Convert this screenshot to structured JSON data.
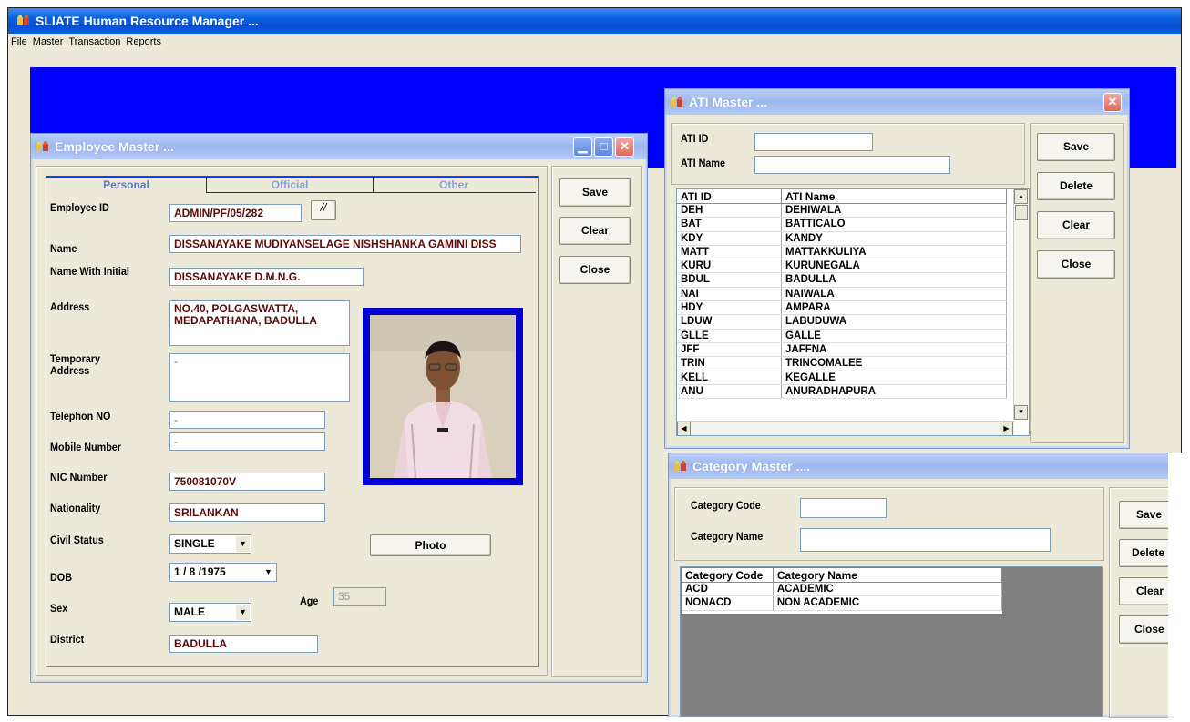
{
  "app": {
    "title": "SLIATE Human Resource Manager ...",
    "menu": [
      "File",
      "Master",
      "Transaction",
      "Reports"
    ]
  },
  "employee": {
    "title": "Employee Master ...",
    "tabs": [
      "Personal",
      "Official",
      "Other"
    ],
    "labels": {
      "employee_id": "Employee ID",
      "name": "Name",
      "name_initial": "Name With Initial",
      "address": "Address",
      "temp_address": "Temporary Address",
      "telephone": "Telephon NO",
      "mobile": "Mobile Number",
      "nic": "NIC Number",
      "nationality": "Nationality",
      "civil_status": "Civil Status",
      "dob": "DOB",
      "sex": "Sex",
      "district": "District",
      "age": "Age"
    },
    "values": {
      "employee_id": "ADMIN/PF/05/282",
      "id_button": "//",
      "name": "DISSANAYAKE MUDIYANSELAGE NISHSHANKA GAMINI DISS",
      "name_initial": "DISSANAYAKE D.M.N.G.",
      "address": "NO.40, POLGASWATTA, MEDAPATHANA, BADULLA",
      "temp_address": "-",
      "telephone": "-",
      "mobile": "-",
      "nic": "750081070V",
      "nationality": "SRILANKAN",
      "civil_status": "SINGLE",
      "dob": "1 / 8 /1975",
      "sex": "MALE",
      "district": "BADULLA",
      "age": "35"
    },
    "photo_button": "Photo",
    "buttons": {
      "save": "Save",
      "clear": "Clear",
      "close": "Close"
    }
  },
  "ati": {
    "title": "ATI Master ...",
    "labels": {
      "id": "ATI ID",
      "name": "ATI Name"
    },
    "columns": [
      "ATI ID",
      "ATI Name"
    ],
    "rows": [
      [
        "DEH",
        "DEHIWALA"
      ],
      [
        "BAT",
        "BATTICALO"
      ],
      [
        "KDY",
        "KANDY"
      ],
      [
        "MATT",
        "MATTAKKULIYA"
      ],
      [
        "KURU",
        "KURUNEGALA"
      ],
      [
        "BDUL",
        "BADULLA"
      ],
      [
        "NAI",
        "NAIWALA"
      ],
      [
        "HDY",
        "AMPARA"
      ],
      [
        "LDUW",
        "LABUDUWA"
      ],
      [
        "GLLE",
        "GALLE"
      ],
      [
        "JFF",
        "JAFFNA"
      ],
      [
        "TRIN",
        "TRINCOMALEE"
      ],
      [
        "KELL",
        "KEGALLE"
      ],
      [
        "ANU",
        "ANURADHAPURA"
      ]
    ],
    "buttons": {
      "save": "Save",
      "delete": "Delete",
      "clear": "Clear",
      "close": "Close"
    }
  },
  "category": {
    "title": "Category Master ....",
    "labels": {
      "code": "Category Code",
      "name": "Category Name"
    },
    "columns": [
      "Category Code",
      "Category Name"
    ],
    "rows": [
      [
        "ACD",
        "ACADEMIC"
      ],
      [
        "NONACD",
        "NON ACADEMIC"
      ]
    ],
    "buttons": {
      "save": "Save",
      "delete": "Delete",
      "clear": "Clear",
      "close": "Close"
    }
  }
}
